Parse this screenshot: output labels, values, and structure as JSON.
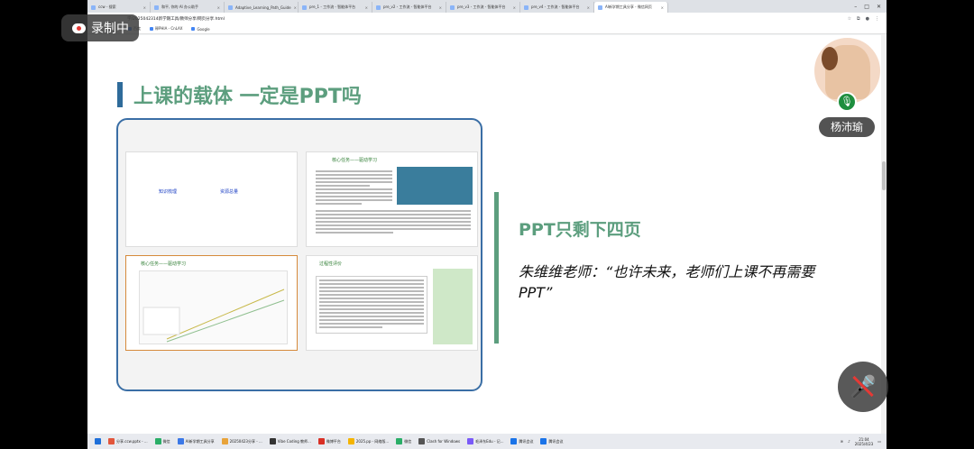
{
  "recording": {
    "label": "录制中"
  },
  "browser": {
    "tabs": [
      {
        "label": "ccw - 搜索"
      },
      {
        "label": "和平, 你的 AI 办公助手"
      },
      {
        "label": "Adaptive_Learning_Path_Guide"
      },
      {
        "label": "pre_1 - 工作流 - 智能体平台"
      },
      {
        "label": "pre_v2 - 工作流 - 智能体平台"
      },
      {
        "label": "pre_v3 - 工作流 - 智能体平台"
      },
      {
        "label": "pre_v4 - 工作流 - 智能体平台"
      },
      {
        "label": "AI新学期工具分享 - 微信网页"
      }
    ],
    "address": "学/2025042314新学期工具/教师分享/网页分享.html",
    "bookmarks": [
      {
        "label": "百度"
      },
      {
        "label": "释PHIA - CnLAX"
      },
      {
        "label": "Google"
      }
    ]
  },
  "page": {
    "title": "上课的载体 一定是PPT吗",
    "slides": {
      "slide1": {
        "link1": "知识梳理",
        "link2": "资源总量"
      },
      "slide2": {
        "heading": "核心任务——驱动学习"
      },
      "slide3": {
        "heading": "核心任务——驱动学习"
      },
      "slide4": {
        "heading": "过程性评价"
      }
    },
    "side_heading": "PPT只剩下四页",
    "quote": "朱维维老师：“也许未来，老师们上课不再需要PPT”"
  },
  "taskbar": {
    "items": [
      {
        "label": "分享.ccw.pptx - ..."
      },
      {
        "label": "微信"
      },
      {
        "label": "AI新学期工具分享"
      },
      {
        "label": "20250423分享 - ..."
      },
      {
        "label": "Vibe Coding 教师..."
      },
      {
        "label": "微博平台"
      },
      {
        "label": "2025.pp - 网络版..."
      },
      {
        "label": "微信"
      },
      {
        "label": "Clash for Windows"
      },
      {
        "label": "毛泽东Edu - 记..."
      },
      {
        "label": "腾讯会议"
      },
      {
        "label": "腾讯会议"
      }
    ],
    "time": "21:04",
    "date": "2025/4/23"
  },
  "participant": {
    "name": "杨沛瑜"
  }
}
